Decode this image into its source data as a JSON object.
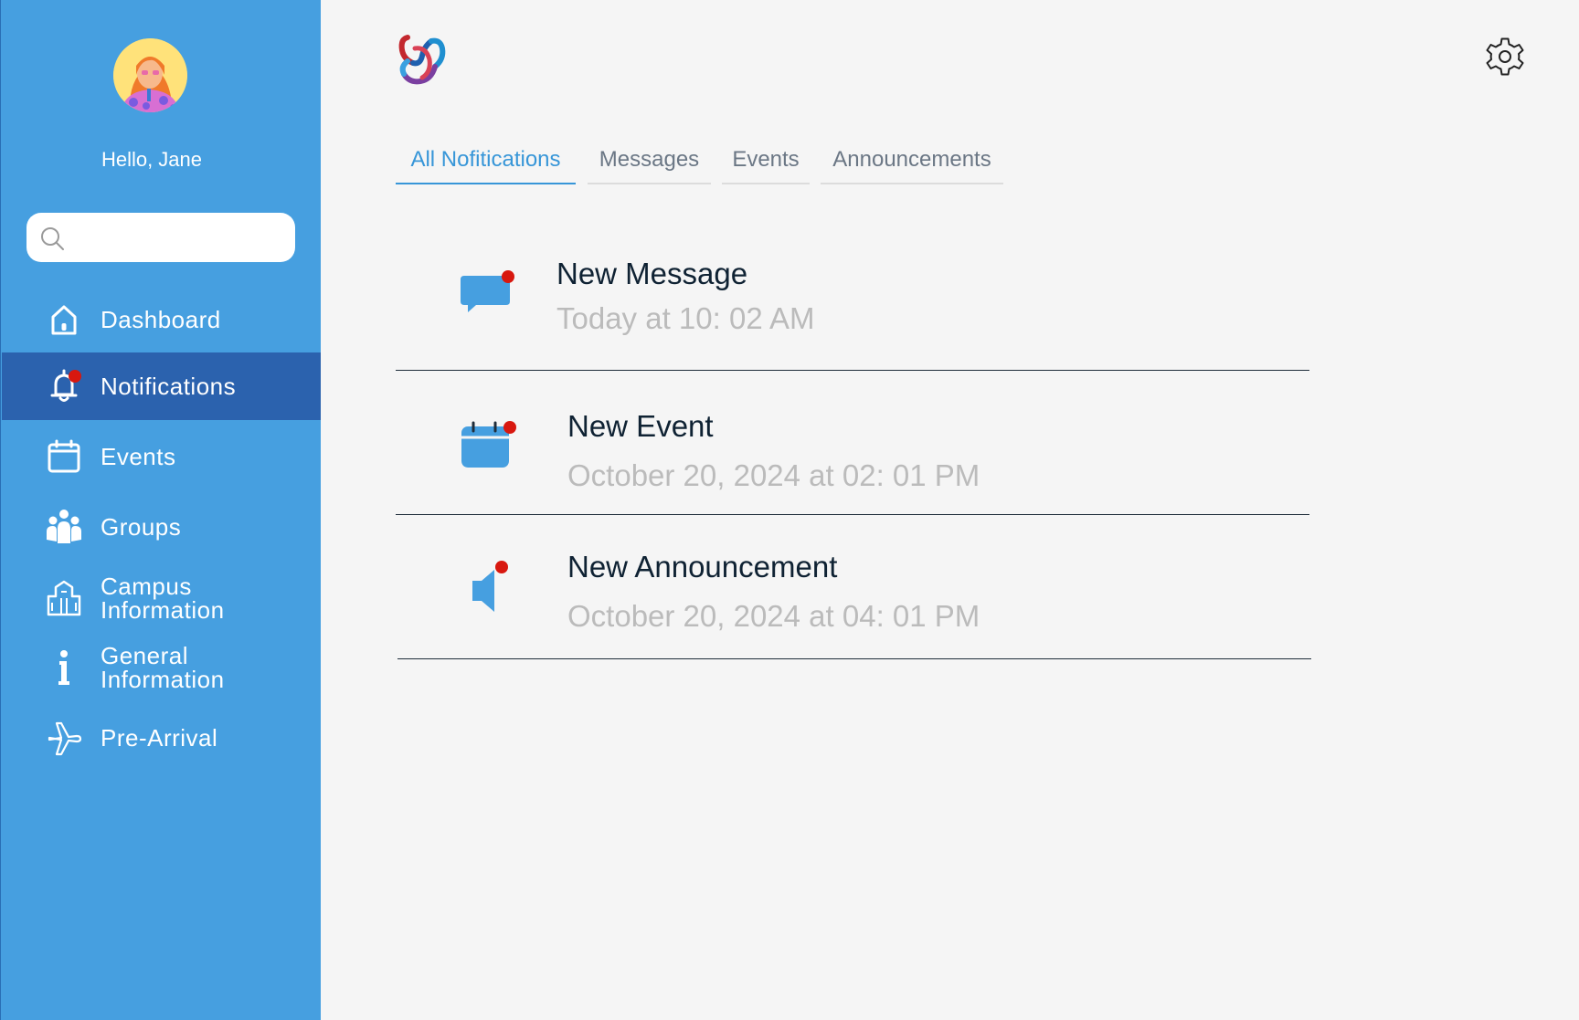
{
  "user": {
    "greeting": "Hello, Jane"
  },
  "search": {
    "placeholder": ""
  },
  "sidebar": {
    "items": [
      {
        "label": "Dashboard",
        "icon": "home-icon"
      },
      {
        "label": "Notifications",
        "icon": "bell-icon",
        "active": true,
        "badge": true
      },
      {
        "label": "Events",
        "icon": "calendar-icon"
      },
      {
        "label": "Groups",
        "icon": "groups-icon"
      },
      {
        "label_line1": "Campus",
        "label_line2": "Information",
        "icon": "building-icon"
      },
      {
        "label_line1": "General",
        "label_line2": "Information",
        "icon": "info-icon"
      },
      {
        "label": "Pre-Arrival",
        "icon": "airplane-icon"
      }
    ]
  },
  "tabs": [
    {
      "label": "All Nofitications",
      "active": true
    },
    {
      "label": "Messages"
    },
    {
      "label": "Events"
    },
    {
      "label": "Announcements"
    }
  ],
  "notifications": [
    {
      "title": "New Message",
      "time": "Today at 10: 02 AM",
      "icon": "message-icon",
      "unread": true
    },
    {
      "title": "New Event",
      "time": "October 20, 2024 at 02: 01 PM",
      "icon": "calendar-icon",
      "unread": true
    },
    {
      "title": "New Announcement",
      "time": "October 20, 2024 at 04: 01 PM",
      "icon": "megaphone-icon",
      "unread": true
    }
  ],
  "colors": {
    "sidebar": "#469fe0",
    "sidebar_active": "#2b62ae",
    "accent": "#3796d8",
    "badge": "#d8180f",
    "title_text": "#0f2233",
    "time_text": "#bbbbbb"
  }
}
